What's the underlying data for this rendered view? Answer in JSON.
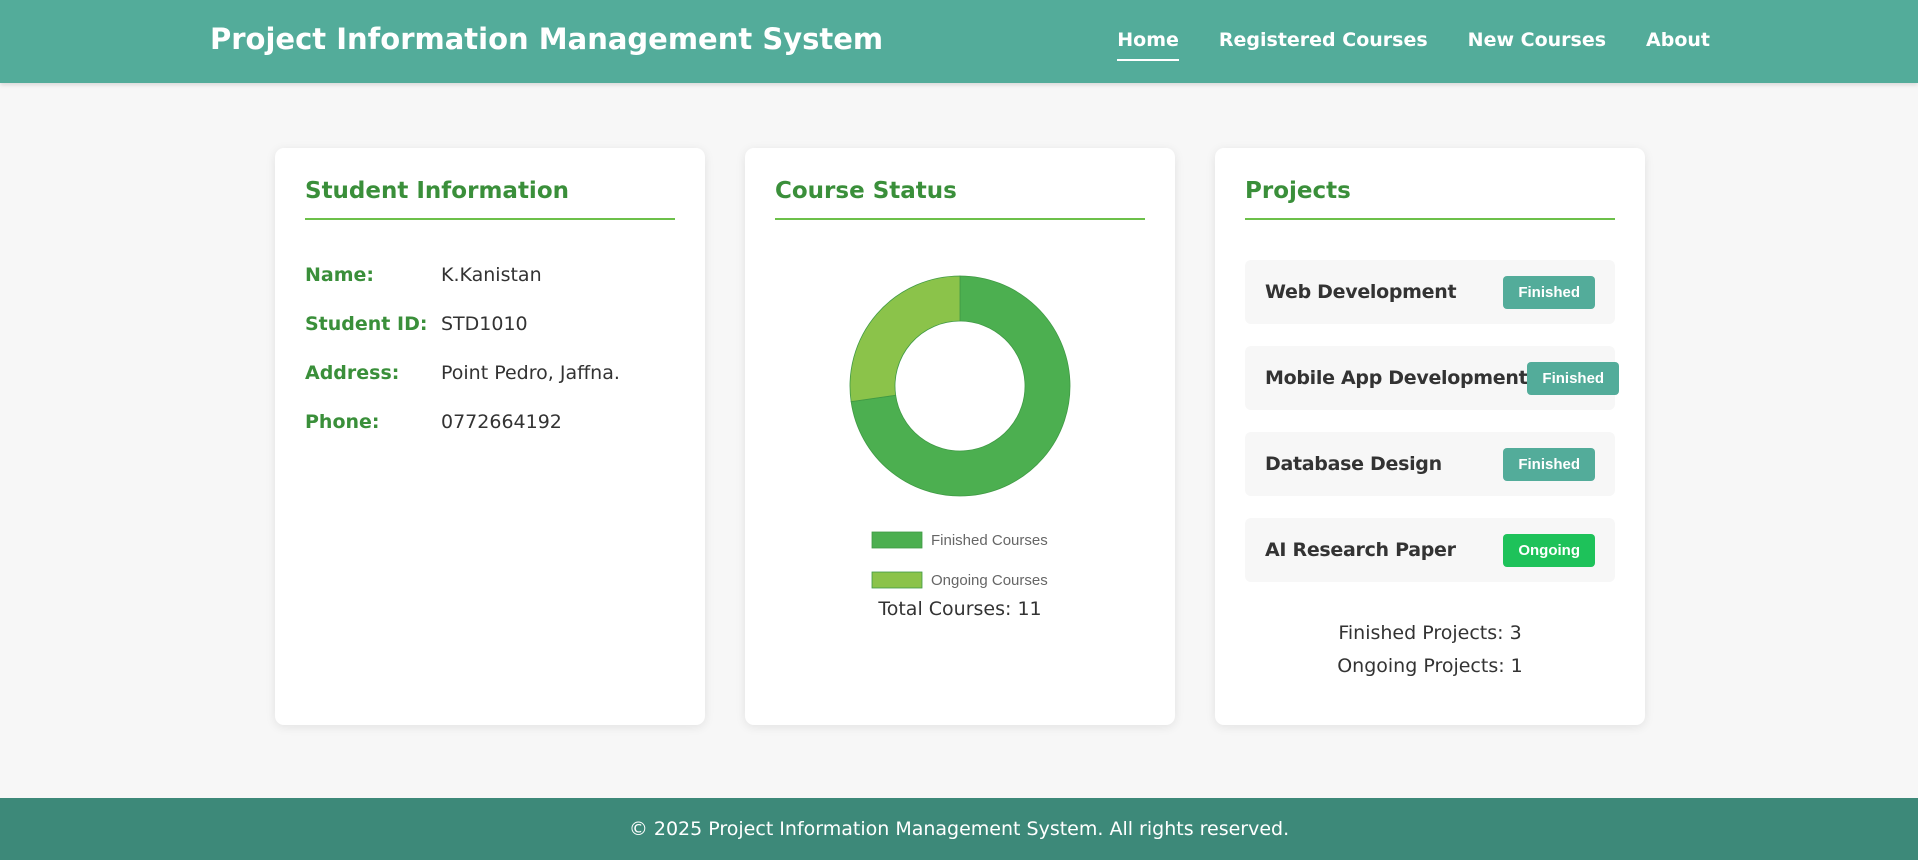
{
  "header": {
    "title": "Project Information Management System",
    "nav": [
      "Home",
      "Registered Courses",
      "New Courses",
      "About"
    ],
    "active_index": 0
  },
  "student": {
    "title": "Student Information",
    "fields": [
      {
        "label": "Name:",
        "value": "K.Kanistan"
      },
      {
        "label": "Student ID:",
        "value": "STD1010"
      },
      {
        "label": "Address:",
        "value": "Point Pedro, Jaffna."
      },
      {
        "label": "Phone:",
        "value": "0772664192"
      }
    ]
  },
  "course_status": {
    "title": "Course Status",
    "total_text": "Total Courses: 11"
  },
  "chart_data": {
    "type": "pie",
    "donut": true,
    "categories": [
      "Finished Courses",
      "Ongoing Courses"
    ],
    "values": [
      8,
      3
    ],
    "colors": [
      "#4caf50",
      "#8bc34a"
    ],
    "legend_position": "bottom"
  },
  "projects": {
    "title": "Projects",
    "items": [
      {
        "name": "Web Development",
        "status": "Finished"
      },
      {
        "name": "Mobile App Development",
        "status": "Finished"
      },
      {
        "name": "Database Design",
        "status": "Finished"
      },
      {
        "name": "AI Research Paper",
        "status": "Ongoing"
      }
    ],
    "finished_text": "Finished Projects: 3",
    "ongoing_text": "Ongoing Projects: 1"
  },
  "footer": {
    "text": "© 2025 Project Information Management System. All rights reserved."
  },
  "colors": {
    "header_bg": "#53ac9a",
    "footer_bg": "#3d8979",
    "heading_green": "#3a8f3a",
    "badge_finished": "#53ac9a",
    "badge_ongoing": "#1ec25a"
  }
}
